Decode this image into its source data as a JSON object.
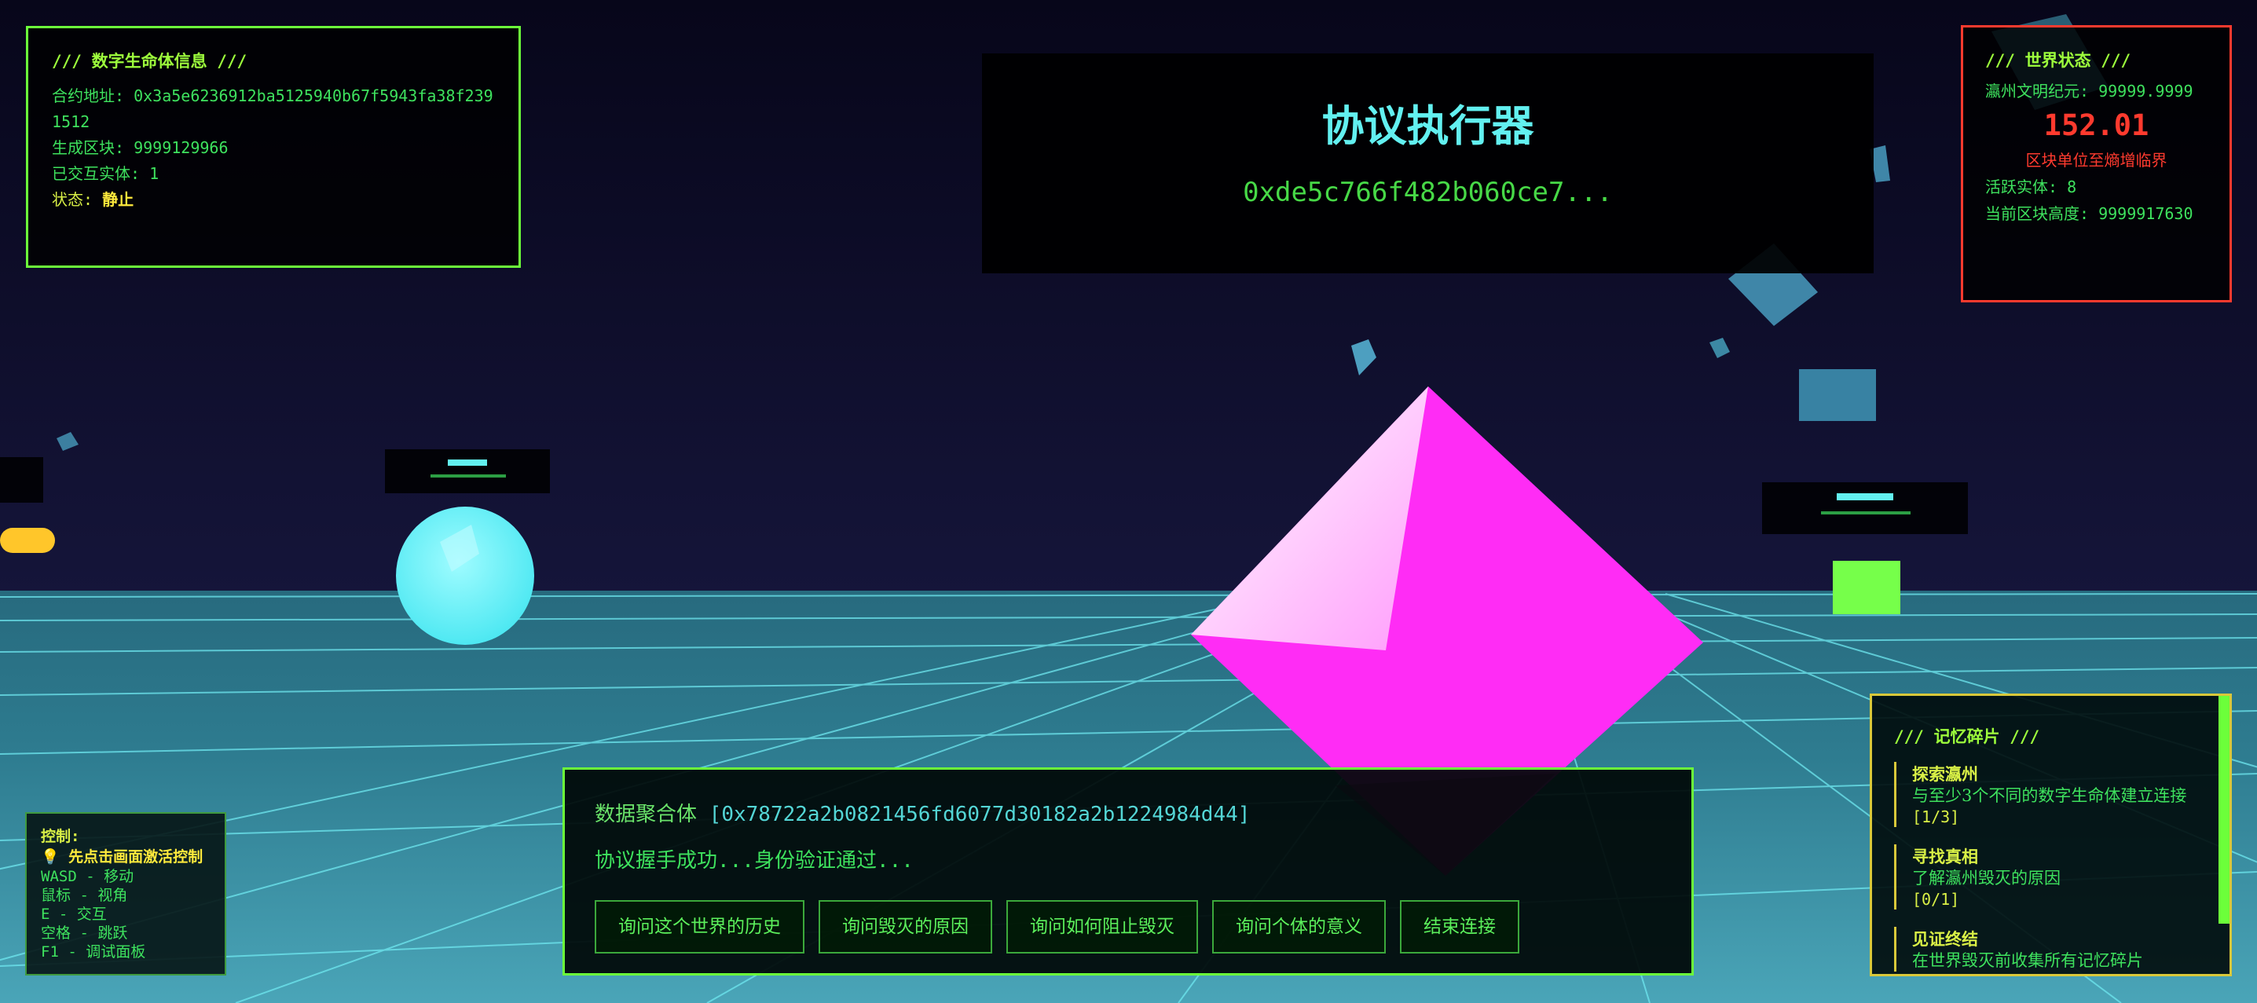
{
  "life_info": {
    "title": "/// 数字生命体信息 ///",
    "contract_label": "合约地址: ",
    "contract_value": "0x3a5e6236912ba5125940b67f5943fa38f2391512",
    "block_label": "生成区块: ",
    "block_value": "9999129966",
    "interacted_label": "已交互实体: ",
    "interacted_value": "1",
    "state_label": "状态: ",
    "state_value": "静止"
  },
  "executor": {
    "title": "协议执行器",
    "address": "0xde5c766f482b060ce7..."
  },
  "world_state": {
    "title": "/// 世界状态 ///",
    "era_label": "瀛州文明纪元: ",
    "era_value": "99999.9999",
    "countdown": "152.01",
    "critical_text": "区块单位至熵增临界",
    "active_label": "活跃实体: ",
    "active_value": "8",
    "height_label": "当前区块高度: ",
    "height_value": "9999917630"
  },
  "controls": {
    "title": "控制:",
    "hint": "先点击画面激活控制",
    "lines": [
      "WASD - 移动",
      "鼠标 - 视角",
      "E - 交互",
      "空格 - 跳跃",
      "F1 - 调试面板"
    ]
  },
  "dialog": {
    "speaker_name": "数据聚合体",
    "speaker_address": "[0x78722a2b0821456fd6077d30182a2b1224984d44]",
    "message": "协议握手成功...身份验证通过...",
    "options": [
      "询问这个世界的历史",
      "询问毁灭的原因",
      "询问如何阻止毁灭",
      "询问个体的意义",
      "结束连接"
    ]
  },
  "memory": {
    "title": "/// 记忆碎片 ///",
    "items": [
      {
        "name": "探索瀛州",
        "desc": "与至少3个不同的数字生命体建立连接",
        "progress": "[1/3]"
      },
      {
        "name": "寻找真相",
        "desc": "了解瀛州毁灭的原因",
        "progress": "[0/1]"
      },
      {
        "name": "见证终结",
        "desc": "在世界毁灭前收集所有记忆碎片",
        "progress": ""
      }
    ]
  },
  "colors": {
    "sky": "#0a0822",
    "grid_floor": "#2f7f93",
    "pyramid": "#ff2cf5",
    "sphere": "#5ff0f5",
    "green_accent": "#6cff3a",
    "alert_red": "#ff3a2e"
  }
}
